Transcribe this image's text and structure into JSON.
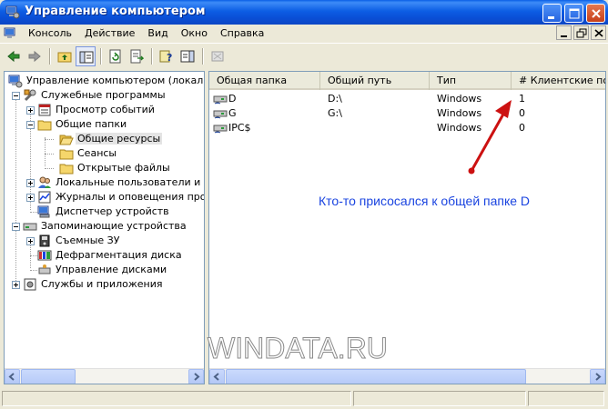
{
  "window": {
    "title": "Управление компьютером",
    "title_icon": "computer-management-icon",
    "buttons": [
      "minimize-icon",
      "maximize-icon",
      "close-icon"
    ]
  },
  "menubar": {
    "items": [
      "Консоль",
      "Действие",
      "Вид",
      "Окно",
      "Справка"
    ]
  },
  "toolbar": {
    "tools": [
      "back-arrow-icon",
      "forward-arrow-icon",
      "up-folder-icon",
      "show-hide-tree-icon",
      "refresh-icon",
      "export-list-icon",
      "help-icon",
      "show-hide-action-pane-icon",
      "disconnect-session-icon"
    ]
  },
  "tree": {
    "items": [
      {
        "label": "Управление компьютером (локальным)",
        "icon": "computer-management-icon",
        "level": 0,
        "expander": "none"
      },
      {
        "label": "Служебные программы",
        "icon": "tools-icon",
        "level": 1,
        "expander": "minus"
      },
      {
        "label": "Просмотр событий",
        "icon": "event-viewer-icon",
        "level": 2,
        "expander": "plus"
      },
      {
        "label": "Общие папки",
        "icon": "folder-icon",
        "level": 2,
        "expander": "minus"
      },
      {
        "label": "Общие ресурсы",
        "icon": "folder-icon",
        "level": 3,
        "expander": "none",
        "selected": true
      },
      {
        "label": "Сеансы",
        "icon": "folder-icon",
        "level": 3,
        "expander": "none"
      },
      {
        "label": "Открытые файлы",
        "icon": "folder-icon",
        "level": 3,
        "expander": "none"
      },
      {
        "label": "Локальные пользователи и группы",
        "icon": "users-icon",
        "level": 2,
        "expander": "plus"
      },
      {
        "label": "Журналы и оповещения производительности",
        "icon": "performance-icon",
        "level": 2,
        "expander": "plus"
      },
      {
        "label": "Диспетчер устройств",
        "icon": "device-manager-icon",
        "level": 2,
        "expander": "none"
      },
      {
        "label": "Запоминающие устройства",
        "icon": "storage-icon",
        "level": 1,
        "expander": "minus"
      },
      {
        "label": "Съемные ЗУ",
        "icon": "removable-storage-icon",
        "level": 2,
        "expander": "plus"
      },
      {
        "label": "Дефрагментация диска",
        "icon": "defrag-icon",
        "level": 2,
        "expander": "none"
      },
      {
        "label": "Управление дисками",
        "icon": "disk-management-icon",
        "level": 2,
        "expander": "none"
      },
      {
        "label": "Службы и приложения",
        "icon": "services-icon",
        "level": 1,
        "expander": "plus"
      }
    ]
  },
  "list": {
    "columns": [
      "Общая папка",
      "Общий путь",
      "Тип",
      "# Клиентские подключения"
    ],
    "rows": [
      {
        "share": "D",
        "path": "D:\\",
        "type": "Windows",
        "clients": "1"
      },
      {
        "share": "G",
        "path": "G:\\",
        "type": "Windows",
        "clients": "0"
      },
      {
        "share": "IPC$",
        "path": "",
        "type": "Windows",
        "clients": "0"
      }
    ],
    "row_icon": "shared-drive-icon"
  },
  "annotation": {
    "text": "Кто-то присосался к общей папке D",
    "color": "#1a44e0",
    "arrow_color": "#cc1111"
  },
  "watermark": "WINDATA.RU"
}
